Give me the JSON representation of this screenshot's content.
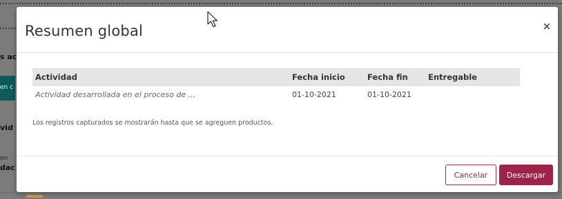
{
  "background": {
    "fragments": [
      "s ac",
      "en c",
      "vid",
      "en",
      "dac"
    ]
  },
  "modal": {
    "title": "Resumen global",
    "close_label": "×",
    "table": {
      "headers": [
        "Actividad",
        "Fecha inicio",
        "Fecha fin",
        "Entregable"
      ],
      "rows": [
        [
          "Actividad desarrollada en el proceso de ...",
          "01-10-2021",
          "01-10-2021",
          ""
        ]
      ]
    },
    "note": "Los registros capturados se mostrarán hasta que se agreguen productos.",
    "buttons": {
      "cancel": "Cancelar",
      "download": "Descargar"
    }
  },
  "colors": {
    "accent": "#9d2449",
    "backdrop": "#7b7b7b",
    "table_header_bg": "#e5e5e5",
    "teal": "#0c5a5a"
  },
  "icons": {
    "close": "close-icon",
    "cursor": "mouse-pointer-icon"
  }
}
